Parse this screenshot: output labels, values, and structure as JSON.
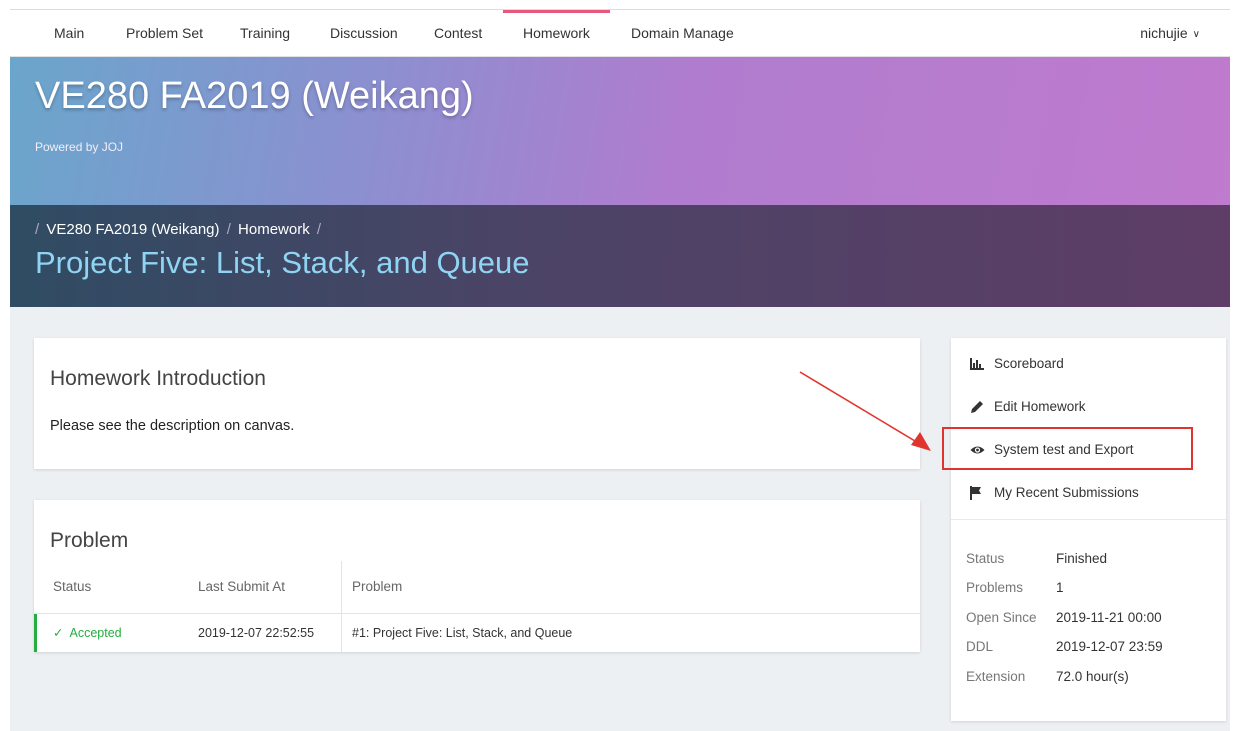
{
  "nav": {
    "items": [
      {
        "label": "Main"
      },
      {
        "label": "Problem Set"
      },
      {
        "label": "Training"
      },
      {
        "label": "Discussion"
      },
      {
        "label": "Contest"
      },
      {
        "label": "Homework"
      },
      {
        "label": "Domain Manage"
      }
    ],
    "active": "Homework",
    "user": "nichujie",
    "accent_color": "#e8577e"
  },
  "hero": {
    "title": "VE280 FA2019 (Weikang)",
    "subtitle": "Powered by JOJ"
  },
  "header": {
    "breadcrumb": [
      "VE280 FA2019 (Weikang)",
      "Homework"
    ],
    "title": "Project Five: List, Stack, and Queue"
  },
  "intro": {
    "heading": "Homework Introduction",
    "text": "Please see the description on canvas."
  },
  "problem": {
    "heading": "Problem",
    "columns": [
      "Status",
      "Last Submit At",
      "Problem"
    ],
    "rows": [
      {
        "status": "Accepted",
        "status_icon": "check-icon",
        "submit_at": "2019-12-07 22:52:55",
        "problem": "#1: Project Five: List, Stack, and Queue"
      }
    ],
    "status_color": "#25ad40"
  },
  "sidebar": {
    "menu": [
      {
        "label": "Scoreboard",
        "icon": "bar-chart-icon"
      },
      {
        "label": "Edit Homework",
        "icon": "pencil-icon"
      },
      {
        "label": "System test and Export",
        "icon": "eye-icon"
      },
      {
        "label": "My Recent Submissions",
        "icon": "flag-icon"
      }
    ],
    "info": [
      {
        "key": "Status",
        "value": "Finished"
      },
      {
        "key": "Problems",
        "value": "1"
      },
      {
        "key": "Open Since",
        "value": "2019-11-21 00:00"
      },
      {
        "key": "DDL",
        "value": "2019-12-07 23:59"
      },
      {
        "key": "Extension",
        "value": "72.0 hour(s)"
      }
    ]
  },
  "annotation": {
    "color": "#e0352e",
    "target": "System test and Export"
  }
}
